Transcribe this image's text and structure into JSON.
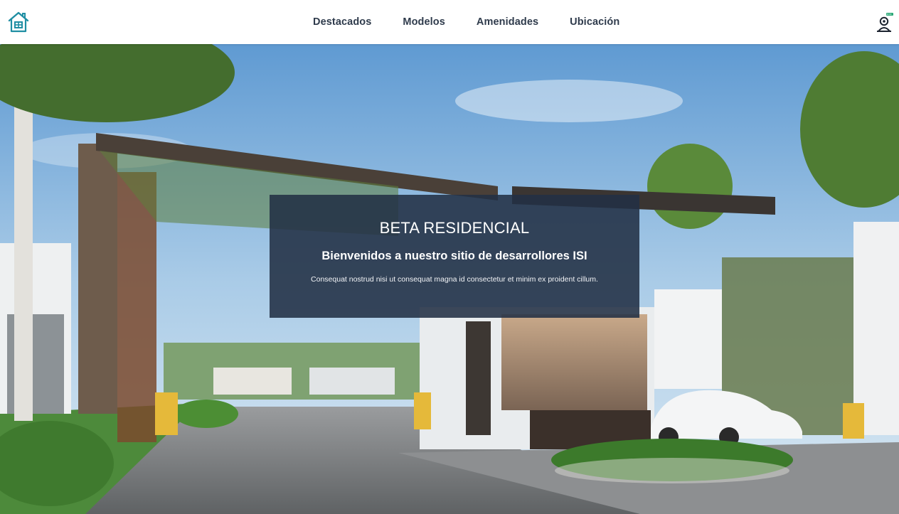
{
  "navbar": {
    "logo_icon": "house-logo-icon",
    "links": [
      {
        "label": "Destacados"
      },
      {
        "label": "Modelos"
      },
      {
        "label": "Amenidades"
      },
      {
        "label": "Ubicación"
      }
    ],
    "user_icon": "user-profile-icon"
  },
  "hero": {
    "title": "BETA RESIDENCIAL",
    "subtitle": "Bienvenidos a nuestro sitio de desarrollores ISI",
    "text": "Consequat nostrud nisi ut consequat magna id consectetur et minim ex proident cillum.",
    "background_image": "residential-entrance-rendering"
  },
  "colors": {
    "nav_text": "#2f3b4c",
    "logo_teal": "#1f8ea3",
    "card_bg": "#223044",
    "card_text": "#ffffff"
  }
}
